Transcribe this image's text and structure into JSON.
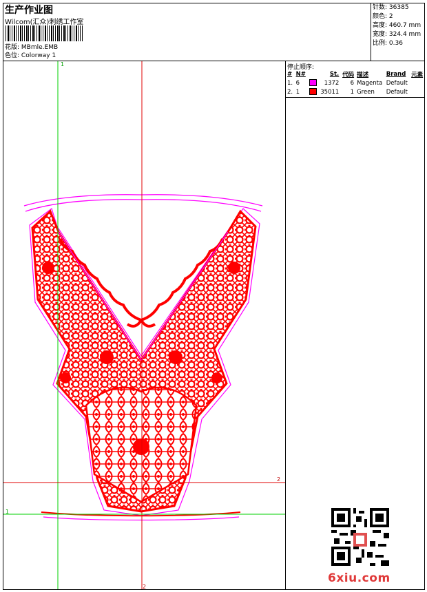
{
  "header": {
    "title": "生产作业图",
    "company": "Wilcom(汇众)刺绣工作室",
    "design_label": "花版:",
    "design_value": "MBmle.EMB",
    "colorway_label": "色位:",
    "colorway_value": "Colorway 1"
  },
  "specs": [
    {
      "label": "针数:",
      "value": "36385"
    },
    {
      "label": "颜色:",
      "value": "2"
    },
    {
      "label": "高度:",
      "value": "460.7 mm"
    },
    {
      "label": "宽度:",
      "value": "324.4 mm"
    },
    {
      "label": "比例:",
      "value": "0.36"
    }
  ],
  "stop_sequence": {
    "title": "停止顺序:",
    "columns": [
      "#",
      "N#",
      "St.",
      "代码",
      "描述",
      "Brand",
      "元素"
    ],
    "rows": [
      {
        "index": "1.",
        "n": "6",
        "color": "#ff00ff",
        "stitches": "1372",
        "code": "6",
        "desc": "Magenta",
        "brand": "Default",
        "element": ""
      },
      {
        "index": "2.",
        "n": "1",
        "color": "#ff0000",
        "stitches": "35011",
        "code": "1",
        "desc": "Green",
        "brand": "Default",
        "element": ""
      }
    ]
  },
  "guides": {
    "v1": "1",
    "v2": "2",
    "h1": "1",
    "h2": "2"
  },
  "watermark": "6xiu.com",
  "colors": {
    "guide_green": "#00d000",
    "guide_red": "#e00000",
    "thread_red": "#ff0000",
    "outline_magenta": "#ff00ff"
  }
}
